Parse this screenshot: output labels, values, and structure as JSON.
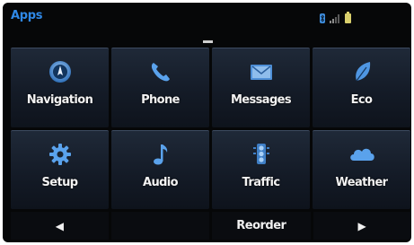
{
  "header": {
    "title": "Apps"
  },
  "apps": [
    {
      "label": "Navigation",
      "icon": "navigation-icon"
    },
    {
      "label": "Phone",
      "icon": "phone-icon"
    },
    {
      "label": "Messages",
      "icon": "messages-icon"
    },
    {
      "label": "Eco",
      "icon": "eco-leaf-icon"
    },
    {
      "label": "Setup",
      "icon": "gear-icon"
    },
    {
      "label": "Audio",
      "icon": "music-note-icon"
    },
    {
      "label": "Traffic",
      "icon": "traffic-light-icon"
    },
    {
      "label": "Weather",
      "icon": "cloud-icon"
    }
  ],
  "footer": {
    "prev_glyph": "◀",
    "reorder_label": "Reorder",
    "next_glyph": "▶"
  },
  "colors": {
    "accent": "#2f88e6",
    "icon_blue": "#3f8fe0",
    "battery": "#d9cf6c"
  }
}
